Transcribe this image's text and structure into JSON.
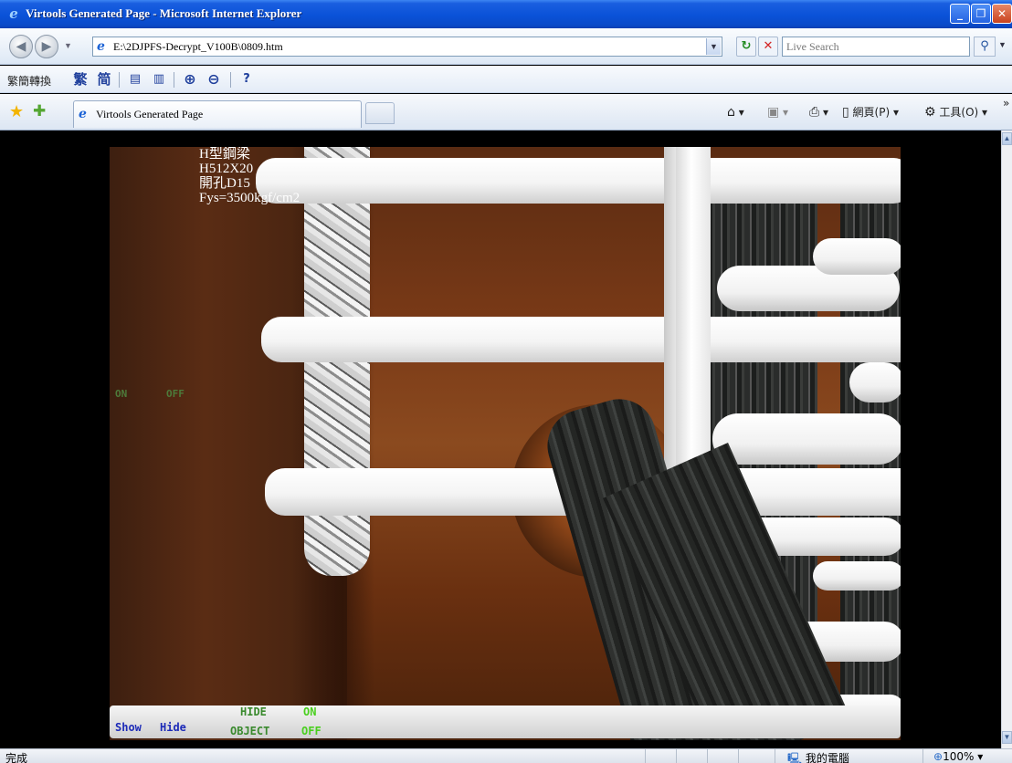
{
  "window": {
    "title": "Virtools Generated Page - Microsoft Internet Explorer",
    "min_glyph": "_",
    "max_glyph": "❐",
    "close_glyph": "✕"
  },
  "address_bar": {
    "url": "E:\\2DJPFS-Decrypt_V100B\\0809.htm",
    "search_placeholder": "Live Search"
  },
  "conversion_toolbar": {
    "label": "繁簡轉換",
    "traditional": "繁",
    "simplified": "简"
  },
  "tab_bar": {
    "tab_title": "Virtools Generated Page",
    "page_menu": "網頁(P)",
    "tools_menu": "工具(O)"
  },
  "viewport": {
    "info_lines": "H型鋼梁\nH512X20\n開孔D15\nFys=3500kgf/cm2",
    "on_label": "ON",
    "off_label": "OFF",
    "show_button": "Show",
    "hide_button": "Hide",
    "hide_label": "HIDE",
    "object_label": "OBJECT",
    "on_button": "ON",
    "off_button": "OFF"
  },
  "status_bar": {
    "status": "完成",
    "zone": "我的電腦",
    "zoom": "100%"
  },
  "colors": {
    "titlebar": "#0a52d8",
    "show_hide_text": "#1d2bb8",
    "on_off_text": "#49cf1e"
  }
}
